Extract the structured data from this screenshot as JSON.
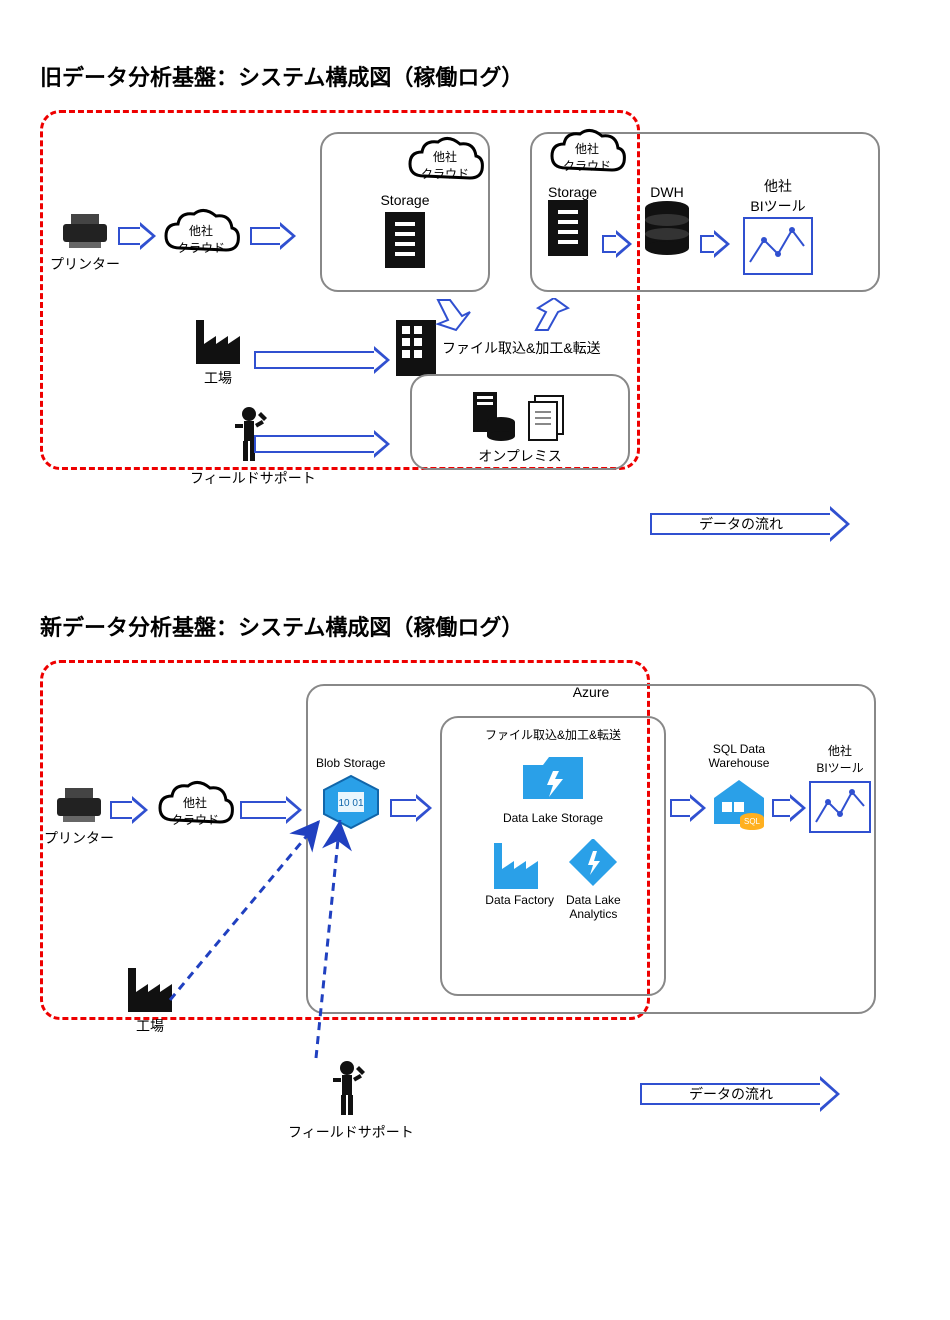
{
  "old": {
    "title": "旧データ分析基盤：システム構成図（稼働ログ）",
    "printer": "プリンター",
    "cloud1": "他社\nクラウド",
    "factory": "工場",
    "support": "フィールドサポート",
    "cloud2": "他社\nクラウド",
    "storage1": "Storage",
    "cloud3": "他社\nクラウド",
    "storage2": "Storage",
    "dwh": "DWH",
    "bi": "他社\nBIツール",
    "process": "ファイル取込&加工&転送",
    "onprem": "オンプレミス",
    "flow": "データの流れ"
  },
  "new": {
    "title": "新データ分析基盤：システム構成図（稼働ログ）",
    "printer": "プリンター",
    "cloud1": "他社\nクラウド",
    "factory": "工場",
    "support": "フィールドサポート",
    "azure": "Azure",
    "blob": "Blob Storage",
    "process": "ファイル取込&加工&転送",
    "dls": "Data Lake Storage",
    "df": "Data Factory",
    "dla": "Data Lake\nAnalytics",
    "sqldw": "SQL Data\nWarehouse",
    "bi": "他社\nBIツール",
    "flow": "データの流れ"
  }
}
